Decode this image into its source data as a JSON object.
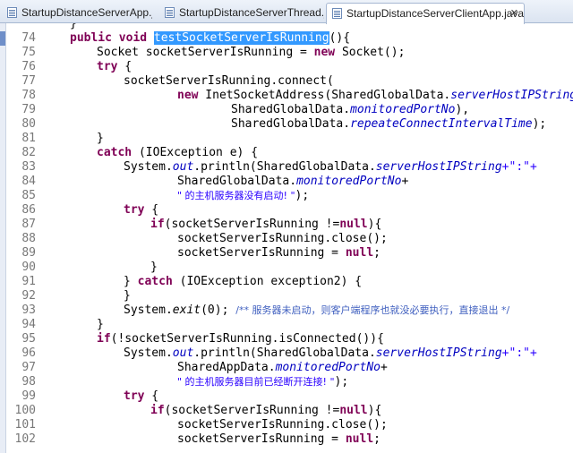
{
  "tabs": [
    {
      "label": "StartupDistanceServerApp.java",
      "active": false
    },
    {
      "label": "StartupDistanceServerThread.java",
      "active": false
    },
    {
      "label": "StartupDistanceServerClientApp.java",
      "active": true,
      "close": "✕"
    }
  ],
  "line_numbers": [
    "74",
    "75",
    "76",
    "77",
    "78",
    "79",
    "80",
    "81",
    "82",
    "83",
    "84",
    "85",
    "86",
    "87",
    "88",
    "89",
    "90",
    "91",
    "92",
    "93",
    "94",
    "95",
    "96",
    "97",
    "98",
    "99",
    "100",
    "101",
    "102"
  ],
  "code": {
    "l73": "}",
    "l74": {
      "kw": "public void ",
      "method": "testSocketServerIsRunning",
      "rest": "(){"
    },
    "l75": {
      "a": "Socket socketServerIsRunning = ",
      "kw": "new",
      "b": " Socket();"
    },
    "l76": {
      "kw": "try",
      "b": " {"
    },
    "l77": "socketServerIsRunning.connect(",
    "l78": {
      "kw": "new",
      "a": " InetSocketAddress(SharedGlobalData.",
      "f": "serverHostIPString",
      "b": ","
    },
    "l79": {
      "a": "SharedGlobalData.",
      "f": "monitoredPortNo",
      "b": "),"
    },
    "l80": {
      "a": "SharedGlobalData.",
      "f": "repeateConnectIntervalTime",
      "b": ");"
    },
    "l81": "}",
    "l82": {
      "kw": "catch",
      "b": " (IOException e) {"
    },
    "l83": {
      "a": "System.",
      "f": "out",
      "b": ".println(SharedGlobalData.",
      "f2": "serverHostIPString",
      "s": "+\":\"+"
    },
    "l84": {
      "a": "SharedGlobalData.",
      "f": "monitoredPortNo",
      "b": "+"
    },
    "l85": {
      "s": "\" 的主机服务器没有启动! \"",
      "b": ");"
    },
    "l86": {
      "kw": "try",
      "b": " {"
    },
    "l87": {
      "kw": "if",
      "a": "(socketServerIsRunning !=",
      "kw2": "null",
      "b": "){"
    },
    "l88": "socketServerIsRunning.close();",
    "l89": {
      "a": "socketServerIsRunning = ",
      "kw": "null",
      "b": ";"
    },
    "l90": "}",
    "l91": {
      "a": "} ",
      "kw": "catch",
      "b": " (IOException exception2) {"
    },
    "l92": "}",
    "l93": {
      "a": "System.",
      "m": "exit",
      "b": "(0); ",
      "c": "/** 服务器未启动，则客户端程序也就没必要执行，直接退出 */"
    },
    "l94": "}",
    "l95": {
      "kw": "if",
      "b": "(!socketServerIsRunning.isConnected()){"
    },
    "l96": {
      "a": "System.",
      "f": "out",
      "b": ".println(SharedGlobalData.",
      "f2": "serverHostIPString",
      "s": "+\":\"+"
    },
    "l97": {
      "a": "SharedAppData.",
      "f": "monitoredPortNo",
      "b": "+"
    },
    "l98": {
      "s": "\" 的主机服务器目前已经断开连接! \"",
      "b": ");"
    },
    "l99": {
      "kw": "try",
      "b": " {"
    },
    "l100": {
      "kw": "if",
      "a": "(socketServerIsRunning !=",
      "kw2": "null",
      "b": "){"
    },
    "l101": "socketServerIsRunning.close();",
    "l102": {
      "a": "socketServerIsRunning = ",
      "kw": "null",
      "b": ";"
    }
  },
  "colors": {
    "keyword": "#7f0055",
    "field": "#0000c0",
    "string": "#2a00ff",
    "comment": "#3f5fbf",
    "selection": "#3399ff",
    "line_number": "#787878"
  },
  "icons": {
    "tab_file": "java-file-icon"
  }
}
